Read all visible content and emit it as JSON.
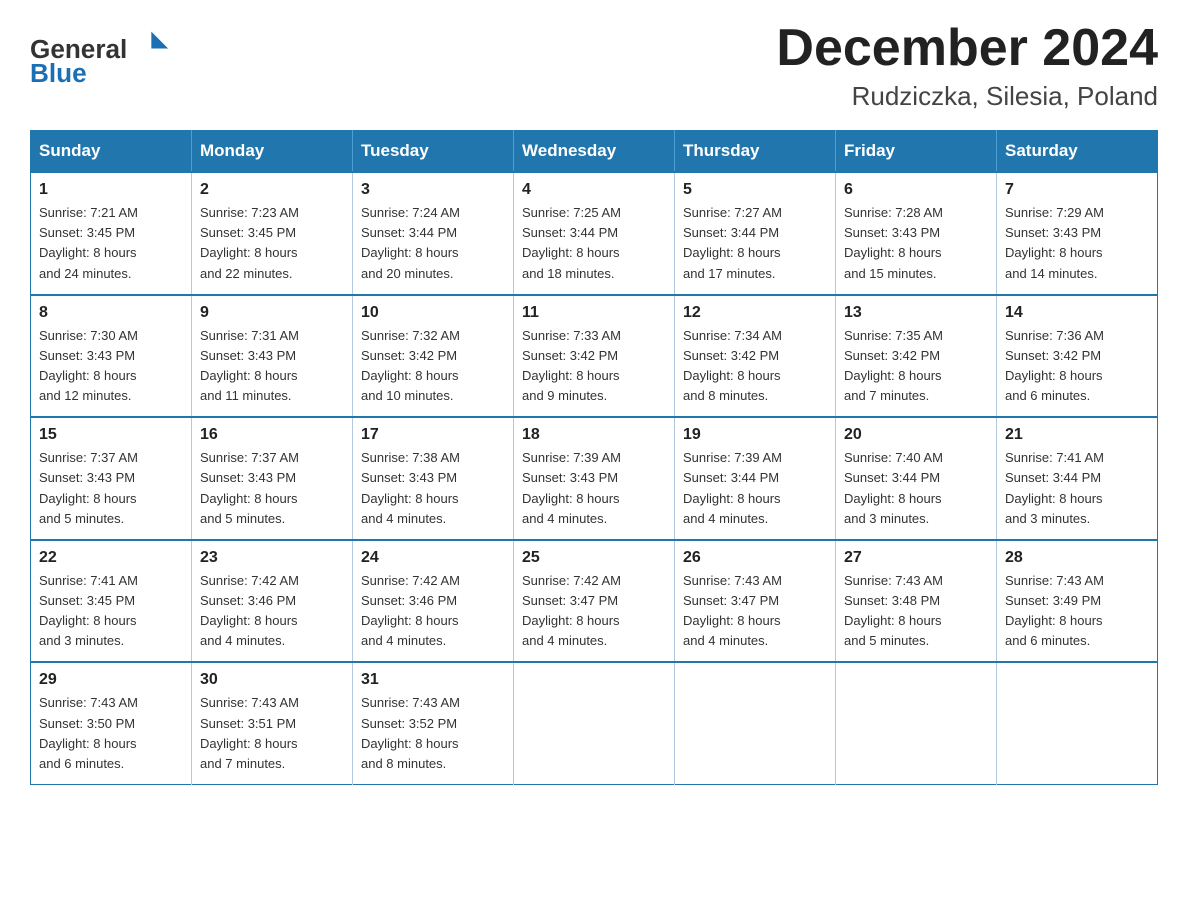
{
  "header": {
    "logo_general": "General",
    "logo_blue": "Blue",
    "title": "December 2024",
    "subtitle": "Rudziczka, Silesia, Poland"
  },
  "days_of_week": [
    "Sunday",
    "Monday",
    "Tuesday",
    "Wednesday",
    "Thursday",
    "Friday",
    "Saturday"
  ],
  "weeks": [
    [
      {
        "day": "1",
        "sunrise": "7:21 AM",
        "sunset": "3:45 PM",
        "daylight": "8 hours and 24 minutes."
      },
      {
        "day": "2",
        "sunrise": "7:23 AM",
        "sunset": "3:45 PM",
        "daylight": "8 hours and 22 minutes."
      },
      {
        "day": "3",
        "sunrise": "7:24 AM",
        "sunset": "3:44 PM",
        "daylight": "8 hours and 20 minutes."
      },
      {
        "day": "4",
        "sunrise": "7:25 AM",
        "sunset": "3:44 PM",
        "daylight": "8 hours and 18 minutes."
      },
      {
        "day": "5",
        "sunrise": "7:27 AM",
        "sunset": "3:44 PM",
        "daylight": "8 hours and 17 minutes."
      },
      {
        "day": "6",
        "sunrise": "7:28 AM",
        "sunset": "3:43 PM",
        "daylight": "8 hours and 15 minutes."
      },
      {
        "day": "7",
        "sunrise": "7:29 AM",
        "sunset": "3:43 PM",
        "daylight": "8 hours and 14 minutes."
      }
    ],
    [
      {
        "day": "8",
        "sunrise": "7:30 AM",
        "sunset": "3:43 PM",
        "daylight": "8 hours and 12 minutes."
      },
      {
        "day": "9",
        "sunrise": "7:31 AM",
        "sunset": "3:43 PM",
        "daylight": "8 hours and 11 minutes."
      },
      {
        "day": "10",
        "sunrise": "7:32 AM",
        "sunset": "3:42 PM",
        "daylight": "8 hours and 10 minutes."
      },
      {
        "day": "11",
        "sunrise": "7:33 AM",
        "sunset": "3:42 PM",
        "daylight": "8 hours and 9 minutes."
      },
      {
        "day": "12",
        "sunrise": "7:34 AM",
        "sunset": "3:42 PM",
        "daylight": "8 hours and 8 minutes."
      },
      {
        "day": "13",
        "sunrise": "7:35 AM",
        "sunset": "3:42 PM",
        "daylight": "8 hours and 7 minutes."
      },
      {
        "day": "14",
        "sunrise": "7:36 AM",
        "sunset": "3:42 PM",
        "daylight": "8 hours and 6 minutes."
      }
    ],
    [
      {
        "day": "15",
        "sunrise": "7:37 AM",
        "sunset": "3:43 PM",
        "daylight": "8 hours and 5 minutes."
      },
      {
        "day": "16",
        "sunrise": "7:37 AM",
        "sunset": "3:43 PM",
        "daylight": "8 hours and 5 minutes."
      },
      {
        "day": "17",
        "sunrise": "7:38 AM",
        "sunset": "3:43 PM",
        "daylight": "8 hours and 4 minutes."
      },
      {
        "day": "18",
        "sunrise": "7:39 AM",
        "sunset": "3:43 PM",
        "daylight": "8 hours and 4 minutes."
      },
      {
        "day": "19",
        "sunrise": "7:39 AM",
        "sunset": "3:44 PM",
        "daylight": "8 hours and 4 minutes."
      },
      {
        "day": "20",
        "sunrise": "7:40 AM",
        "sunset": "3:44 PM",
        "daylight": "8 hours and 3 minutes."
      },
      {
        "day": "21",
        "sunrise": "7:41 AM",
        "sunset": "3:44 PM",
        "daylight": "8 hours and 3 minutes."
      }
    ],
    [
      {
        "day": "22",
        "sunrise": "7:41 AM",
        "sunset": "3:45 PM",
        "daylight": "8 hours and 3 minutes."
      },
      {
        "day": "23",
        "sunrise": "7:42 AM",
        "sunset": "3:46 PM",
        "daylight": "8 hours and 4 minutes."
      },
      {
        "day": "24",
        "sunrise": "7:42 AM",
        "sunset": "3:46 PM",
        "daylight": "8 hours and 4 minutes."
      },
      {
        "day": "25",
        "sunrise": "7:42 AM",
        "sunset": "3:47 PM",
        "daylight": "8 hours and 4 minutes."
      },
      {
        "day": "26",
        "sunrise": "7:43 AM",
        "sunset": "3:47 PM",
        "daylight": "8 hours and 4 minutes."
      },
      {
        "day": "27",
        "sunrise": "7:43 AM",
        "sunset": "3:48 PM",
        "daylight": "8 hours and 5 minutes."
      },
      {
        "day": "28",
        "sunrise": "7:43 AM",
        "sunset": "3:49 PM",
        "daylight": "8 hours and 6 minutes."
      }
    ],
    [
      {
        "day": "29",
        "sunrise": "7:43 AM",
        "sunset": "3:50 PM",
        "daylight": "8 hours and 6 minutes."
      },
      {
        "day": "30",
        "sunrise": "7:43 AM",
        "sunset": "3:51 PM",
        "daylight": "8 hours and 7 minutes."
      },
      {
        "day": "31",
        "sunrise": "7:43 AM",
        "sunset": "3:52 PM",
        "daylight": "8 hours and 8 minutes."
      },
      null,
      null,
      null,
      null
    ]
  ],
  "labels": {
    "sunrise": "Sunrise:",
    "sunset": "Sunset:",
    "daylight": "Daylight:"
  }
}
